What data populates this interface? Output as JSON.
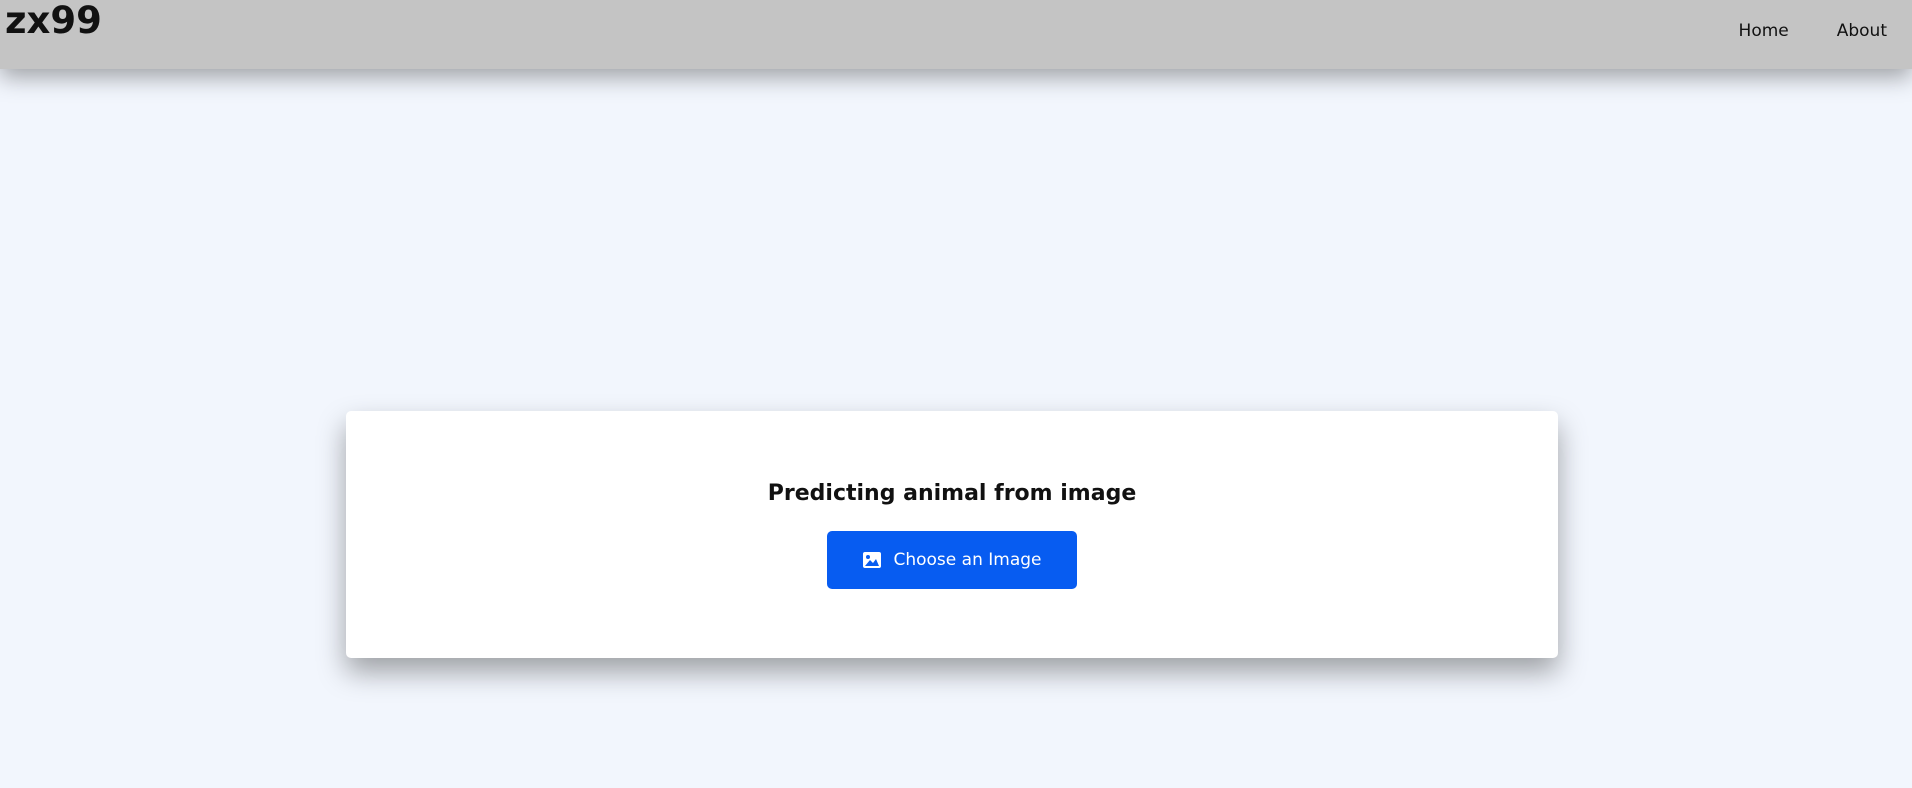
{
  "header": {
    "brand": "zx99",
    "nav": [
      {
        "label": "Home"
      },
      {
        "label": "About"
      }
    ]
  },
  "main": {
    "title": "Predicting animal from image",
    "choose_button": {
      "label": "Choose an Image",
      "icon": "image-icon"
    }
  },
  "colors": {
    "navbar_bg": "#c4c4c4",
    "page_bg": "#f2f6fd",
    "card_bg": "#ffffff",
    "button_bg": "#075cf1",
    "button_text": "#ffffff"
  }
}
